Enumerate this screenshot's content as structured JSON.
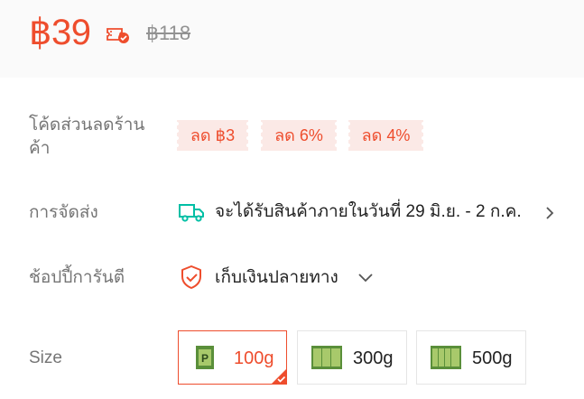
{
  "price": {
    "current": "฿39",
    "original": "฿118",
    "voucher_icon": "ticket-check-icon"
  },
  "vouchers": {
    "label": "โค้ดส่วนลดร้านค้า",
    "items": [
      "ลด ฿3",
      "ลด 6%",
      "ลด 4%"
    ]
  },
  "shipping": {
    "label": "การจัดส่ง",
    "icon": "truck-icon",
    "text": "จะได้รับสินค้าภายในวันที่ 29 มิ.ย. - 2 ก.ค."
  },
  "guarantee": {
    "label": "ช้อปปี้การันตี",
    "icon": "shield-icon",
    "value": "เก็บเงินปลายทาง"
  },
  "size": {
    "label": "Size",
    "options": [
      {
        "label": "100g",
        "selected": true
      },
      {
        "label": "300g",
        "selected": false
      },
      {
        "label": "500g",
        "selected": false
      }
    ]
  },
  "colors": {
    "accent": "#ee4d2d",
    "voucher_bg": "#fbe9e6",
    "shipping_icon": "#00bfa5",
    "label_gray": "#757575"
  }
}
